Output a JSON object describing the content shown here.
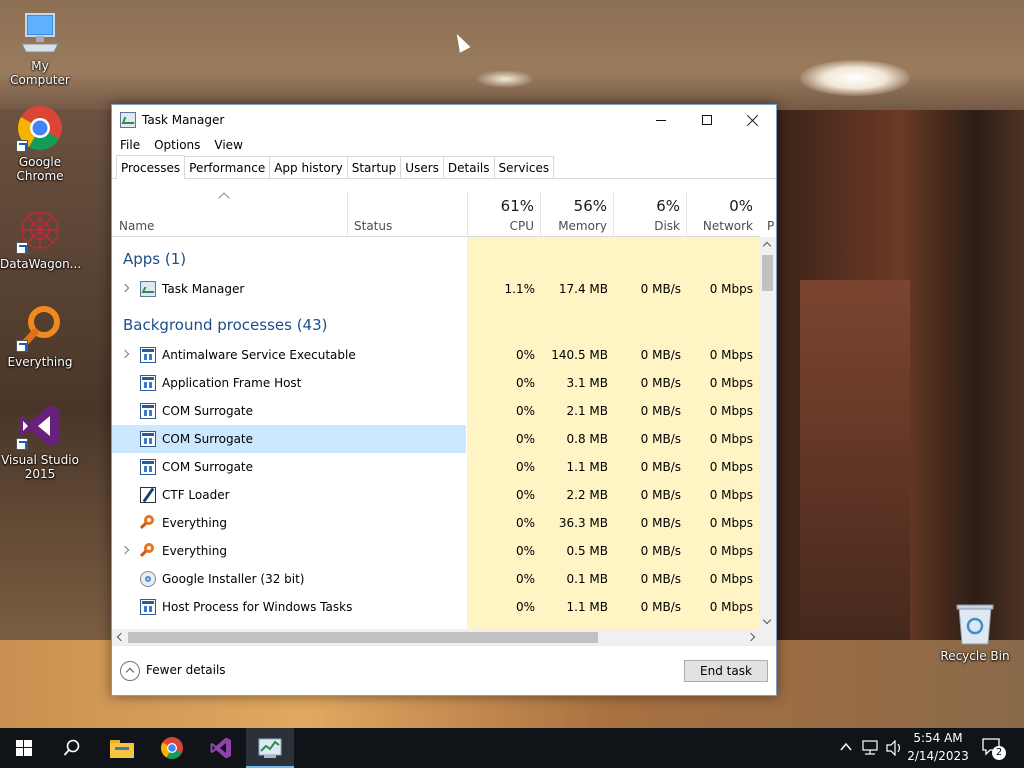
{
  "desktop": {
    "icons": [
      {
        "label": "My Computer",
        "icon": "computer-icon"
      },
      {
        "label": "Google Chrome",
        "icon": "chrome-icon"
      },
      {
        "label": "DataWagon...",
        "icon": "datawagon-icon"
      },
      {
        "label": "Everything",
        "icon": "everything-icon"
      },
      {
        "label": "Visual Studio 2015",
        "icon": "visual-studio-icon"
      },
      {
        "label": "Recycle Bin",
        "icon": "recycle-bin-icon"
      }
    ]
  },
  "window": {
    "title": "Task Manager",
    "menu": [
      "File",
      "Options",
      "View"
    ],
    "tabs": [
      "Processes",
      "Performance",
      "App history",
      "Startup",
      "Users",
      "Details",
      "Services"
    ],
    "active_tab": "Processes"
  },
  "columns": {
    "name": "Name",
    "status": "Status",
    "cpu": {
      "pct": "61%",
      "label": "CPU"
    },
    "memory": {
      "pct": "56%",
      "label": "Memory"
    },
    "disk": {
      "pct": "6%",
      "label": "Disk"
    },
    "network": {
      "pct": "0%",
      "label": "Network"
    },
    "extra": "P"
  },
  "groups": {
    "apps": "Apps (1)",
    "background": "Background processes (43)"
  },
  "apps": [
    {
      "name": "Task Manager",
      "cpu": "1.1%",
      "memory": "17.4 MB",
      "disk": "0 MB/s",
      "network": "0 Mbps",
      "icon": "task-manager-icon",
      "expandable": true
    }
  ],
  "background": [
    {
      "name": "Antimalware Service Executable",
      "cpu": "0%",
      "memory": "140.5 MB",
      "disk": "0 MB/s",
      "network": "0 Mbps",
      "icon": "service-icon",
      "expandable": true
    },
    {
      "name": "Application Frame Host",
      "cpu": "0%",
      "memory": "3.1 MB",
      "disk": "0 MB/s",
      "network": "0 Mbps",
      "icon": "service-icon",
      "expandable": false
    },
    {
      "name": "COM Surrogate",
      "cpu": "0%",
      "memory": "2.1 MB",
      "disk": "0 MB/s",
      "network": "0 Mbps",
      "icon": "service-icon",
      "expandable": false
    },
    {
      "name": "COM Surrogate",
      "cpu": "0%",
      "memory": "0.8 MB",
      "disk": "0 MB/s",
      "network": "0 Mbps",
      "icon": "service-icon",
      "expandable": false,
      "selected": true
    },
    {
      "name": "COM Surrogate",
      "cpu": "0%",
      "memory": "1.1 MB",
      "disk": "0 MB/s",
      "network": "0 Mbps",
      "icon": "service-icon",
      "expandable": false
    },
    {
      "name": "CTF Loader",
      "cpu": "0%",
      "memory": "2.2 MB",
      "disk": "0 MB/s",
      "network": "0 Mbps",
      "icon": "ctf-loader-icon",
      "expandable": false
    },
    {
      "name": "Everything",
      "cpu": "0%",
      "memory": "36.3 MB",
      "disk": "0 MB/s",
      "network": "0 Mbps",
      "icon": "everything-icon",
      "expandable": false
    },
    {
      "name": "Everything",
      "cpu": "0%",
      "memory": "0.5 MB",
      "disk": "0 MB/s",
      "network": "0 Mbps",
      "icon": "everything-icon",
      "expandable": true
    },
    {
      "name": "Google Installer (32 bit)",
      "cpu": "0%",
      "memory": "0.1 MB",
      "disk": "0 MB/s",
      "network": "0 Mbps",
      "icon": "google-installer-icon",
      "expandable": false
    },
    {
      "name": "Host Process for Windows Tasks",
      "cpu": "0%",
      "memory": "1.1 MB",
      "disk": "0 MB/s",
      "network": "0 Mbps",
      "icon": "service-icon",
      "expandable": false
    }
  ],
  "footer": {
    "fewer_details": "Fewer details",
    "end_task": "End task"
  },
  "taskbar": {
    "time": "5:54 AM",
    "date": "2/14/2023",
    "notification_count": "2",
    "pinned": [
      "start-icon",
      "search-icon",
      "file-explorer-icon",
      "chrome-icon",
      "visual-studio-icon",
      "task-manager-icon"
    ]
  },
  "colors": {
    "accent": "#1e4e8c",
    "heat": "#fff4c4",
    "selected_row": "#cce8ff",
    "taskbar": "#101418"
  }
}
